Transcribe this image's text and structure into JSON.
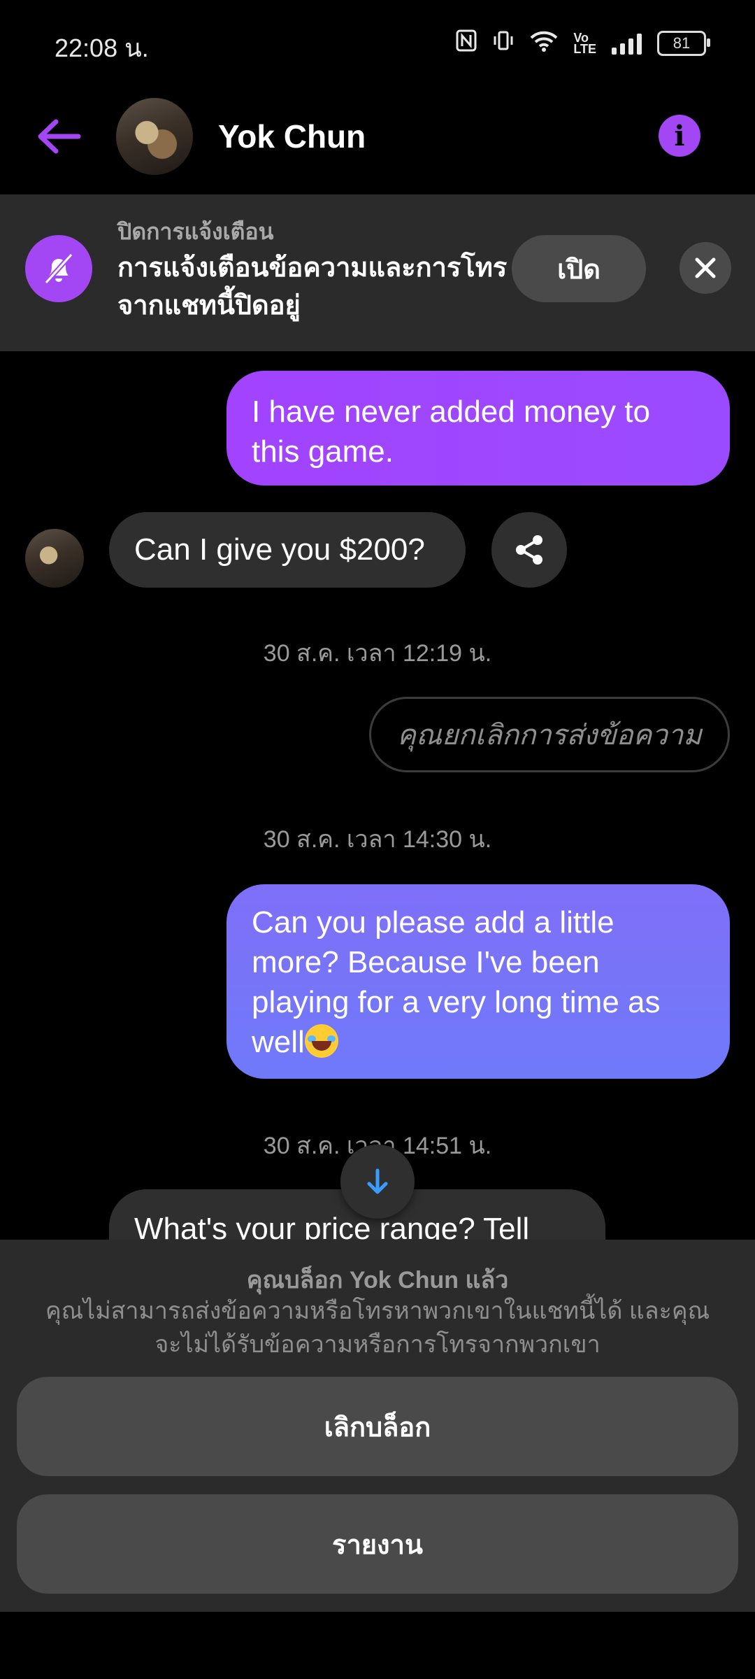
{
  "status_bar": {
    "time": "22:08 น.",
    "battery": "81"
  },
  "header": {
    "contact_name": "Yok Chun"
  },
  "mute_banner": {
    "title": "ปิดการแจ้งเตือน",
    "description": "การแจ้งเตือนข้อความและการโทรจากแชทนี้ปิดอยู่",
    "open_label": "เปิด"
  },
  "messages": [
    {
      "direction": "outgoing",
      "text": "I have never added money to this game."
    },
    {
      "direction": "incoming",
      "text": "Can I give you $200?"
    },
    {
      "direction": "timestamp",
      "text": "30 ส.ค. เวลา 12:19 น."
    },
    {
      "direction": "outgoing-unsent",
      "text": "คุณยกเลิกการส่งข้อความ"
    },
    {
      "direction": "timestamp",
      "text": "30 ส.ค. เวลา 14:30 น."
    },
    {
      "direction": "outgoing",
      "text": "Can you please add a little more? Because I've been playing for a very long time as well",
      "emoji": "😂"
    },
    {
      "direction": "timestamp",
      "text": "30 ส.ค. เวลา 14:51 น."
    },
    {
      "direction": "incoming",
      "text": "What's your price range? Tell"
    }
  ],
  "block_panel": {
    "title": "คุณบล็อก Yok Chun แล้ว",
    "description": "คุณไม่สามารถส่งข้อความหรือโทรหาพวกเขาในแชทนี้ได้ และคุณจะไม่ได้รับข้อความหรือการโทรจากพวกเขา",
    "unblock_label": "เลิกบล็อก",
    "report_label": "รายงาน"
  },
  "colors": {
    "accent": "#a347f5",
    "bubble_out": "#9a4bff",
    "bubble_out_2": "#7478f9",
    "bubble_in": "#2f2f2f",
    "scroll_arrow": "#3b9cff"
  }
}
